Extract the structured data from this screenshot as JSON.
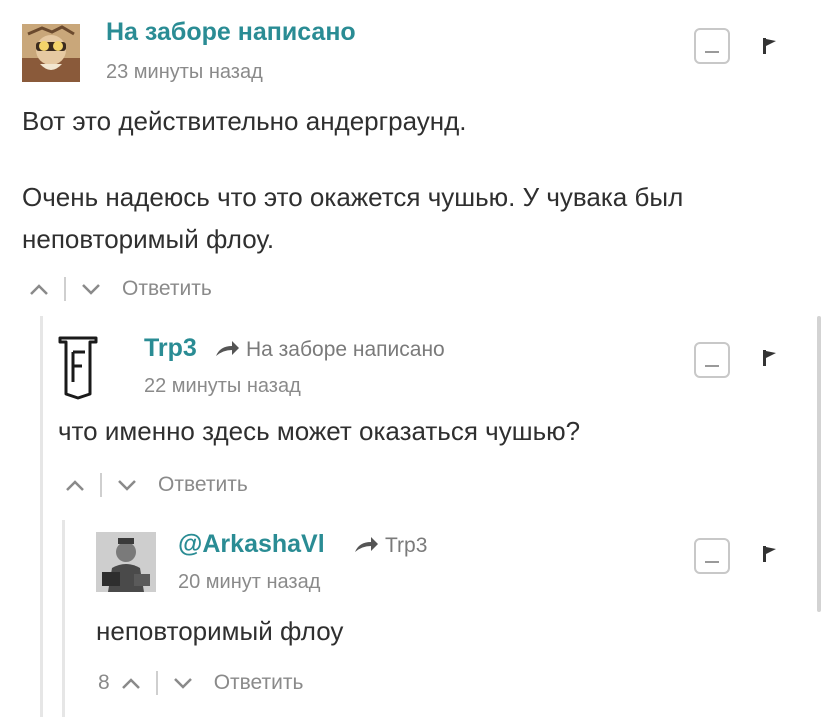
{
  "comments": [
    {
      "author": "На заборе написано",
      "reply_to": "",
      "time": "23 минуты назад",
      "paragraphs": [
        "Вот это действительно андерграунд.",
        "Очень надеюсь что это окажется чушью. У чувака был неповторимый флоу."
      ],
      "vote_count": "",
      "reply_label": "Ответить",
      "avatar": "avatar-photo-icon"
    },
    {
      "author": "Trp3",
      "reply_to": "На заборе написано",
      "time": "22 минуты назад",
      "paragraphs": [
        "что именно здесь может оказаться чушью?"
      ],
      "vote_count": "",
      "reply_label": "Ответить",
      "avatar": "letter-f-logo-icon"
    },
    {
      "author": "@ArkashaVl",
      "reply_to": "Trp3",
      "time": "20 минут назад",
      "paragraphs": [
        "неповторимый флоу"
      ],
      "vote_count": "8",
      "reply_label": "Ответить",
      "avatar": "avatar-photo-icon"
    }
  ],
  "colors": {
    "author": "#2a8c94",
    "muted": "#8a8a8a",
    "thread_line": "#e6e6e6"
  }
}
